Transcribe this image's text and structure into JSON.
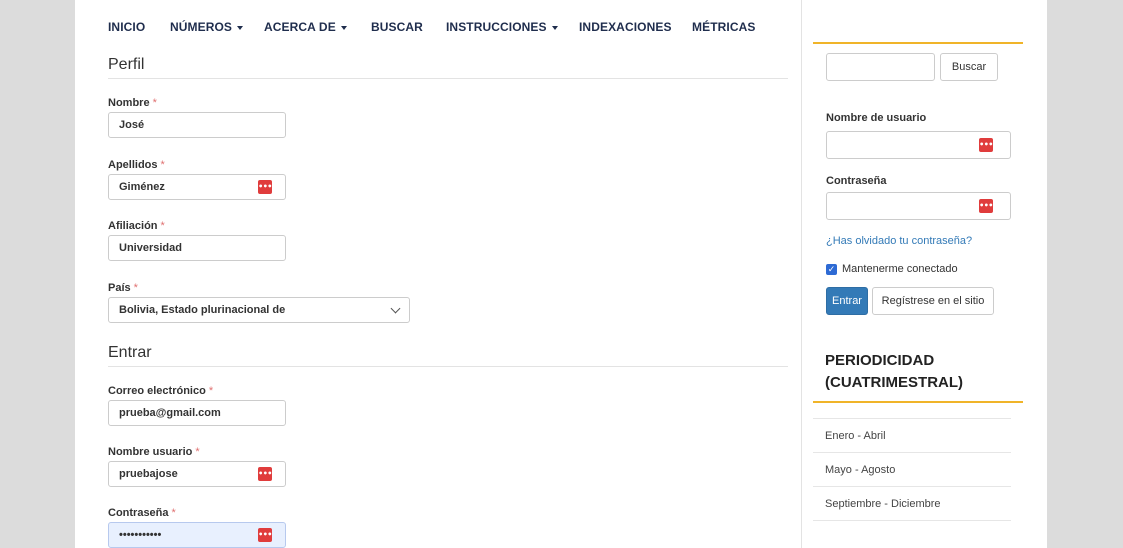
{
  "nav": {
    "items": [
      {
        "label": "INICIO",
        "dropdown": false
      },
      {
        "label": "NÚMEROS",
        "dropdown": true
      },
      {
        "label": "ACERCA DE",
        "dropdown": true
      },
      {
        "label": "BUSCAR",
        "dropdown": false
      },
      {
        "label": "INSTRUCCIONES",
        "dropdown": true
      },
      {
        "label": "INDEXACIONES",
        "dropdown": false
      },
      {
        "label": "MÉTRICAS",
        "dropdown": false
      }
    ]
  },
  "profile": {
    "section_title": "Perfil",
    "nombre": {
      "label": "Nombre",
      "required": "*",
      "value": "José"
    },
    "apellidos": {
      "label": "Apellidos",
      "required": "*",
      "value": "Giménez"
    },
    "afiliacion": {
      "label": "Afiliación",
      "required": "*",
      "value": "Universidad"
    },
    "pais": {
      "label": "País",
      "required": "*",
      "value": "Bolivia, Estado plurinacional de"
    }
  },
  "login_section": {
    "section_title": "Entrar",
    "correo": {
      "label": "Correo electrónico",
      "required": "*",
      "value": "prueba@gmail.com"
    },
    "usuario": {
      "label": "Nombre usuario",
      "required": "*",
      "value": "pruebajose"
    },
    "contrasena": {
      "label": "Contraseña",
      "required": "*",
      "value": "•••••••••••"
    }
  },
  "sidebar": {
    "search_button": "Buscar",
    "username_label": "Nombre de usuario",
    "password_label": "Contraseña",
    "forgot_link": "¿Has olvidado tu contraseña?",
    "remember_label": "Mantenerme conectado",
    "remember_checked": true,
    "enter_button": "Entrar",
    "register_button": "Regístrese en el sitio",
    "periodicity_title_line1": "PERIODICIDAD",
    "periodicity_title_line2": "(CUATRIMESTRAL)",
    "periods": [
      "Enero - Abril",
      "Mayo - Agosto",
      "Septiembre - Diciembre"
    ]
  },
  "colors": {
    "accent_orange": "#f0b429",
    "primary_blue": "#337ab7",
    "password_icon_red": "#e03c3c",
    "gutter_gray": "#dcdcdc"
  },
  "icons": {
    "password_manager": "password-manager-icon",
    "dropdown_caret": "caret-down-icon",
    "select_chevron": "chevron-down-icon",
    "checkbox": "checkmark-icon"
  }
}
